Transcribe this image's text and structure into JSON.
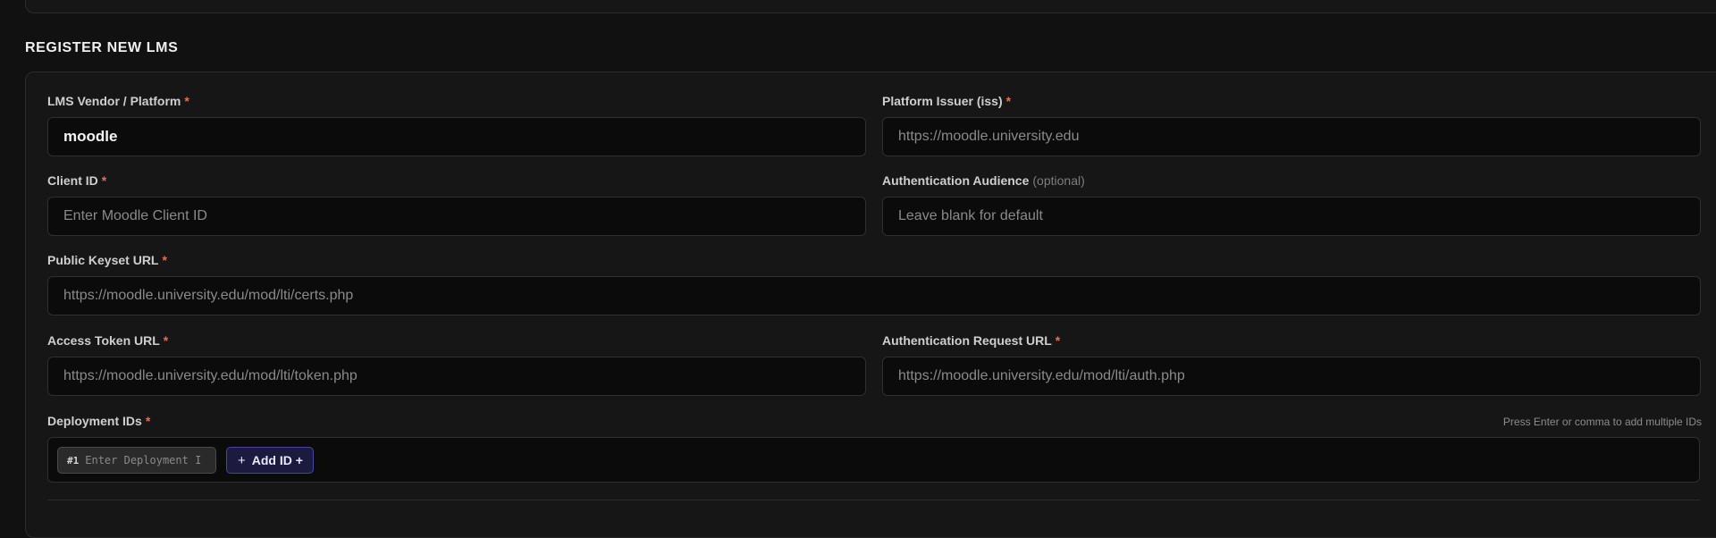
{
  "section": {
    "title": "REGISTER NEW LMS"
  },
  "fields": {
    "lms_vendor": {
      "label": "LMS Vendor / Platform",
      "required_mark": "*",
      "value": "moodle"
    },
    "platform_issuer": {
      "label": "Platform Issuer (iss)",
      "required_mark": "*",
      "placeholder": "https://moodle.university.edu"
    },
    "client_id": {
      "label": "Client ID",
      "required_mark": "*",
      "placeholder": "Enter Moodle Client ID"
    },
    "auth_audience": {
      "label": "Authentication Audience",
      "optional_note": "(optional)",
      "placeholder": "Leave blank for default"
    },
    "public_keyset_url": {
      "label": "Public Keyset URL",
      "required_mark": "*",
      "placeholder": "https://moodle.university.edu/mod/lti/certs.php"
    },
    "access_token_url": {
      "label": "Access Token URL",
      "required_mark": "*",
      "placeholder": "https://moodle.university.edu/mod/lti/token.php"
    },
    "auth_request_url": {
      "label": "Authentication Request URL",
      "required_mark": "*",
      "placeholder": "https://moodle.university.edu/mod/lti/auth.php"
    }
  },
  "deployment": {
    "label": "Deployment IDs",
    "required_mark": "*",
    "helper": "Press Enter or comma to add multiple IDs",
    "chips": [
      {
        "number": "#1",
        "placeholder": "Enter Deployment ID"
      }
    ],
    "add_button": {
      "icon": "+",
      "label": "Add ID +"
    }
  },
  "icons": {
    "add_button_icon": "plus-icon"
  },
  "colors": {
    "background": "#111111",
    "card": "#161616",
    "input": "#0b0b0b",
    "required": "#e0705a",
    "accent": "#4a45a0"
  }
}
